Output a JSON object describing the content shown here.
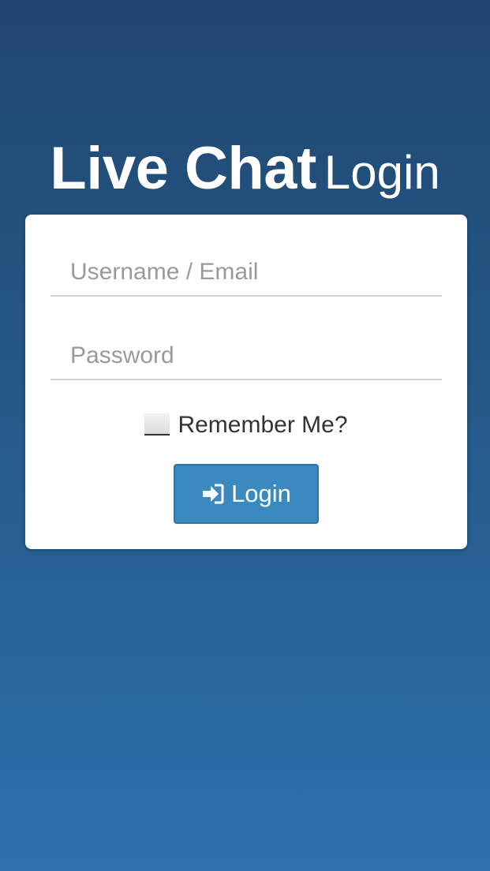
{
  "header": {
    "title_main": "Live Chat",
    "title_sub": "Login"
  },
  "form": {
    "username_placeholder": "Username / Email",
    "username_value": "",
    "password_placeholder": "Password",
    "password_value": "",
    "remember_label": "Remember Me?",
    "remember_checked": false,
    "login_label": "Login",
    "login_icon": "sign-in-icon"
  },
  "colors": {
    "background_top": "#1f4670",
    "background_bottom": "#2d70ad",
    "card": "#ffffff",
    "button": "#3a8ac0"
  }
}
